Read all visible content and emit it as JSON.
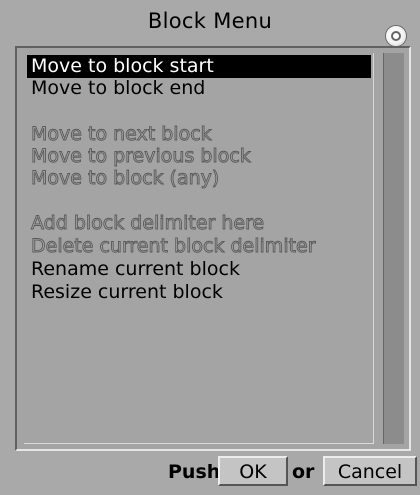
{
  "window": {
    "title": "Block Menu"
  },
  "menu": {
    "items": [
      {
        "label": "Move to block start",
        "state": "selected"
      },
      {
        "label": "Move to block end",
        "state": "enabled"
      },
      {
        "label": "Move to next block",
        "state": "disabled"
      },
      {
        "label": "Move to previous block",
        "state": "disabled"
      },
      {
        "label": "Move to block (any)",
        "state": "disabled"
      },
      {
        "label": "Add block delimiter here",
        "state": "disabled"
      },
      {
        "label": "Delete current block delimiter",
        "state": "disabled"
      },
      {
        "label": "Rename current block",
        "state": "enabled"
      },
      {
        "label": "Resize current block",
        "state": "enabled"
      }
    ]
  },
  "footer": {
    "push_label": "Push",
    "ok_label": "OK",
    "or_label": "or",
    "cancel_label": "Cancel"
  },
  "icons": {
    "close": "close-circle-icon"
  },
  "colors": {
    "background": "#a9a9a9",
    "selection": "#000000",
    "selection_text": "#ffffff",
    "disabled_text": "#5a5a5a"
  }
}
